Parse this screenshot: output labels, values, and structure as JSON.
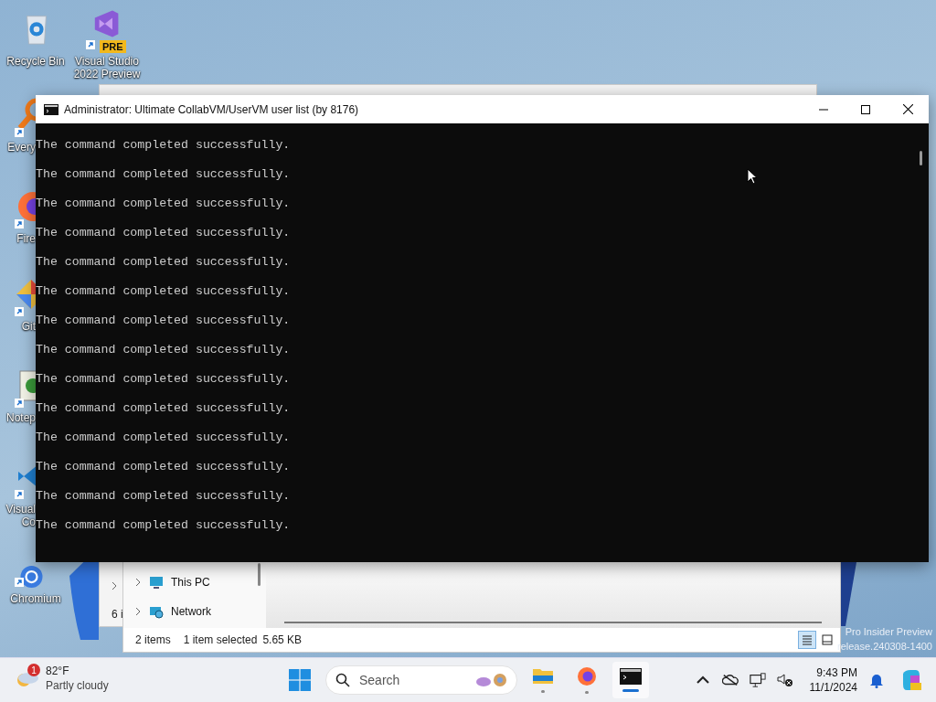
{
  "desktop_icons": [
    {
      "kind": "recycle",
      "label": "Recycle Bin"
    },
    {
      "kind": "vs",
      "label": "Visual Studio 2022 Preview",
      "badge": "PRE"
    },
    {
      "kind": "search",
      "label": "Every"
    },
    {
      "kind": "firefox",
      "label": "Fire"
    },
    {
      "kind": "git",
      "label": "Git"
    },
    {
      "kind": "notepad",
      "label": "Notep"
    },
    {
      "kind": "vscode",
      "label": "Visual Co"
    },
    {
      "kind": "chromium",
      "label": "Chromium"
    }
  ],
  "back_window": {
    "status_text": "6 i"
  },
  "explorer": {
    "nav_items": [
      {
        "kind": "pc",
        "label": "This PC"
      },
      {
        "kind": "network",
        "label": "Network"
      }
    ],
    "status": {
      "count": "2 items",
      "selection": "1 item selected",
      "size": "5.65 KB"
    },
    "view_buttons": [
      {
        "kind": "details",
        "selected": true
      },
      {
        "kind": "tiles",
        "selected": false
      }
    ]
  },
  "console": {
    "title": "Administrator:  Ultimate CollabVM/UserVM user list (by 8176)",
    "lines": [
      "The command completed successfully.",
      "The command completed successfully.",
      "The command completed successfully.",
      "The command completed successfully.",
      "The command completed successfully.",
      "The command completed successfully.",
      "The command completed successfully.",
      "The command completed successfully.",
      "The command completed successfully.",
      "The command completed successfully.",
      "The command completed successfully.",
      "The command completed successfully.",
      "The command completed successfully.",
      "The command completed successfully."
    ]
  },
  "watermark": [
    "Pro Insider Preview",
    "release.240308-1400"
  ],
  "taskbar": {
    "weather": {
      "badge": "1",
      "temperature": "82°F",
      "condition": "Partly cloudy"
    },
    "search": {
      "placeholder": "Search"
    },
    "apps": [
      {
        "kind": "files",
        "selected": false
      },
      {
        "kind": "firefox",
        "selected": false
      },
      {
        "kind": "terminal",
        "selected": true
      }
    ],
    "tray": [
      {
        "kind": "chevron"
      },
      {
        "kind": "cloud"
      },
      {
        "kind": "network"
      },
      {
        "kind": "sound"
      }
    ],
    "clock": {
      "time": "9:43 PM",
      "date": "11/1/2024"
    }
  }
}
